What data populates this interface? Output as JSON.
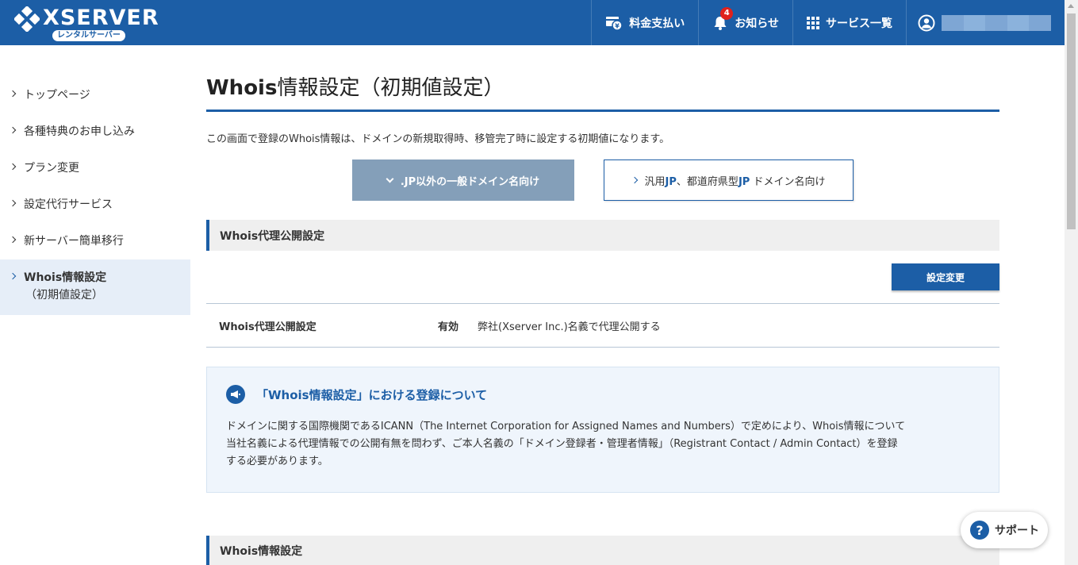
{
  "header": {
    "logo_text": "XSERVER",
    "logo_sub": "レンタルサーバー",
    "nav": {
      "billing": "料金支払い",
      "news": "お知らせ",
      "news_badge": "4",
      "services": "サービス一覧"
    }
  },
  "sidebar": {
    "items": [
      {
        "label": "トップページ"
      },
      {
        "label": "各種特典のお申し込み"
      },
      {
        "label": "プラン変更"
      },
      {
        "label": "設定代行サービス"
      },
      {
        "label": "新サーバー簡単移行"
      },
      {
        "label": "Whois情報設定",
        "sub": "（初期値設定）"
      }
    ]
  },
  "main": {
    "title_bold": "Whois",
    "title_rest": "情報設定（初期値設定）",
    "intro": "この画面で登録のWhois情報は、ドメインの新規取得時、移管完了時に設定する初期値になります。",
    "tabs": {
      "active": ".JP以外の一般ドメイン名向け",
      "inactive_a": "汎用",
      "inactive_b": "JP",
      "inactive_c": "、都道府県型",
      "inactive_d": "JP",
      "inactive_e": " ドメイン名向け"
    },
    "section1_title": "Whois代理公開設定",
    "change_button": "設定変更",
    "setting": {
      "label": "Whois代理公開設定",
      "status": "有効",
      "description": "弊社(Xserver Inc.)名義で代理公開する"
    },
    "notice": {
      "title": "「Whois情報設定」における登録について",
      "body_line1": "ドメインに関する国際機関であるICANN（The Internet Corporation for Assigned Names and Numbers）で定めにより、Whois情報について",
      "body_line2": "当社名義による代理情報での公開有無を問わず、ご本人名義の「ドメイン登録者・管理者情報」（Registrant Contact / Admin Contact）を登録",
      "body_line3": "する必要があります。"
    },
    "section2_title": "Whois情報設定"
  },
  "support_label": "サポート",
  "colors": {
    "brand": "#1c5ea6",
    "tab_active": "#849fb9",
    "notice_bg": "#eff5fc",
    "badge": "#e0211b"
  }
}
